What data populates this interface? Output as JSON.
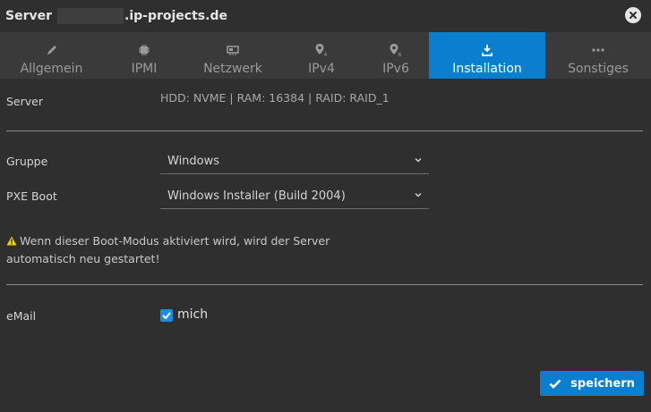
{
  "window": {
    "title_prefix": "Server",
    "title_suffix": ".ip-projects.de"
  },
  "tabs": [
    {
      "label": "Allgemein",
      "icon": "pencil-icon",
      "active": false
    },
    {
      "label": "IPMI",
      "icon": "chip-icon",
      "active": false
    },
    {
      "label": "Netzwerk",
      "icon": "network-card-icon",
      "active": false
    },
    {
      "label": "IPv4",
      "icon": "map-marker-icon",
      "active": false
    },
    {
      "label": "IPv6",
      "icon": "map-marker-icon",
      "active": false
    },
    {
      "label": "Installation",
      "icon": "download-icon",
      "active": true
    },
    {
      "label": "Sonstiges",
      "icon": "more-dots-icon",
      "active": false
    }
  ],
  "form": {
    "server_label": "Server",
    "server_value": "HDD: NVME | RAM: 16384 | RAID: RAID_1",
    "gruppe_label": "Gruppe",
    "gruppe_value": "Windows",
    "pxe_label": "PXE Boot",
    "pxe_value": "Windows Installer (Build 2004)",
    "warning_line1": "Wenn dieser Boot-Modus aktiviert wird, wird der Server",
    "warning_line2": "automatisch neu gestartet!",
    "email_label": "eMail",
    "email_checkbox_label": "mich",
    "email_checked": true
  },
  "actions": {
    "save_label": "speichern"
  },
  "colors": {
    "accent": "#0a7fd0",
    "background": "#2f2f2f",
    "tabbar": "#3a3a3a",
    "warning": "#f0d000"
  }
}
